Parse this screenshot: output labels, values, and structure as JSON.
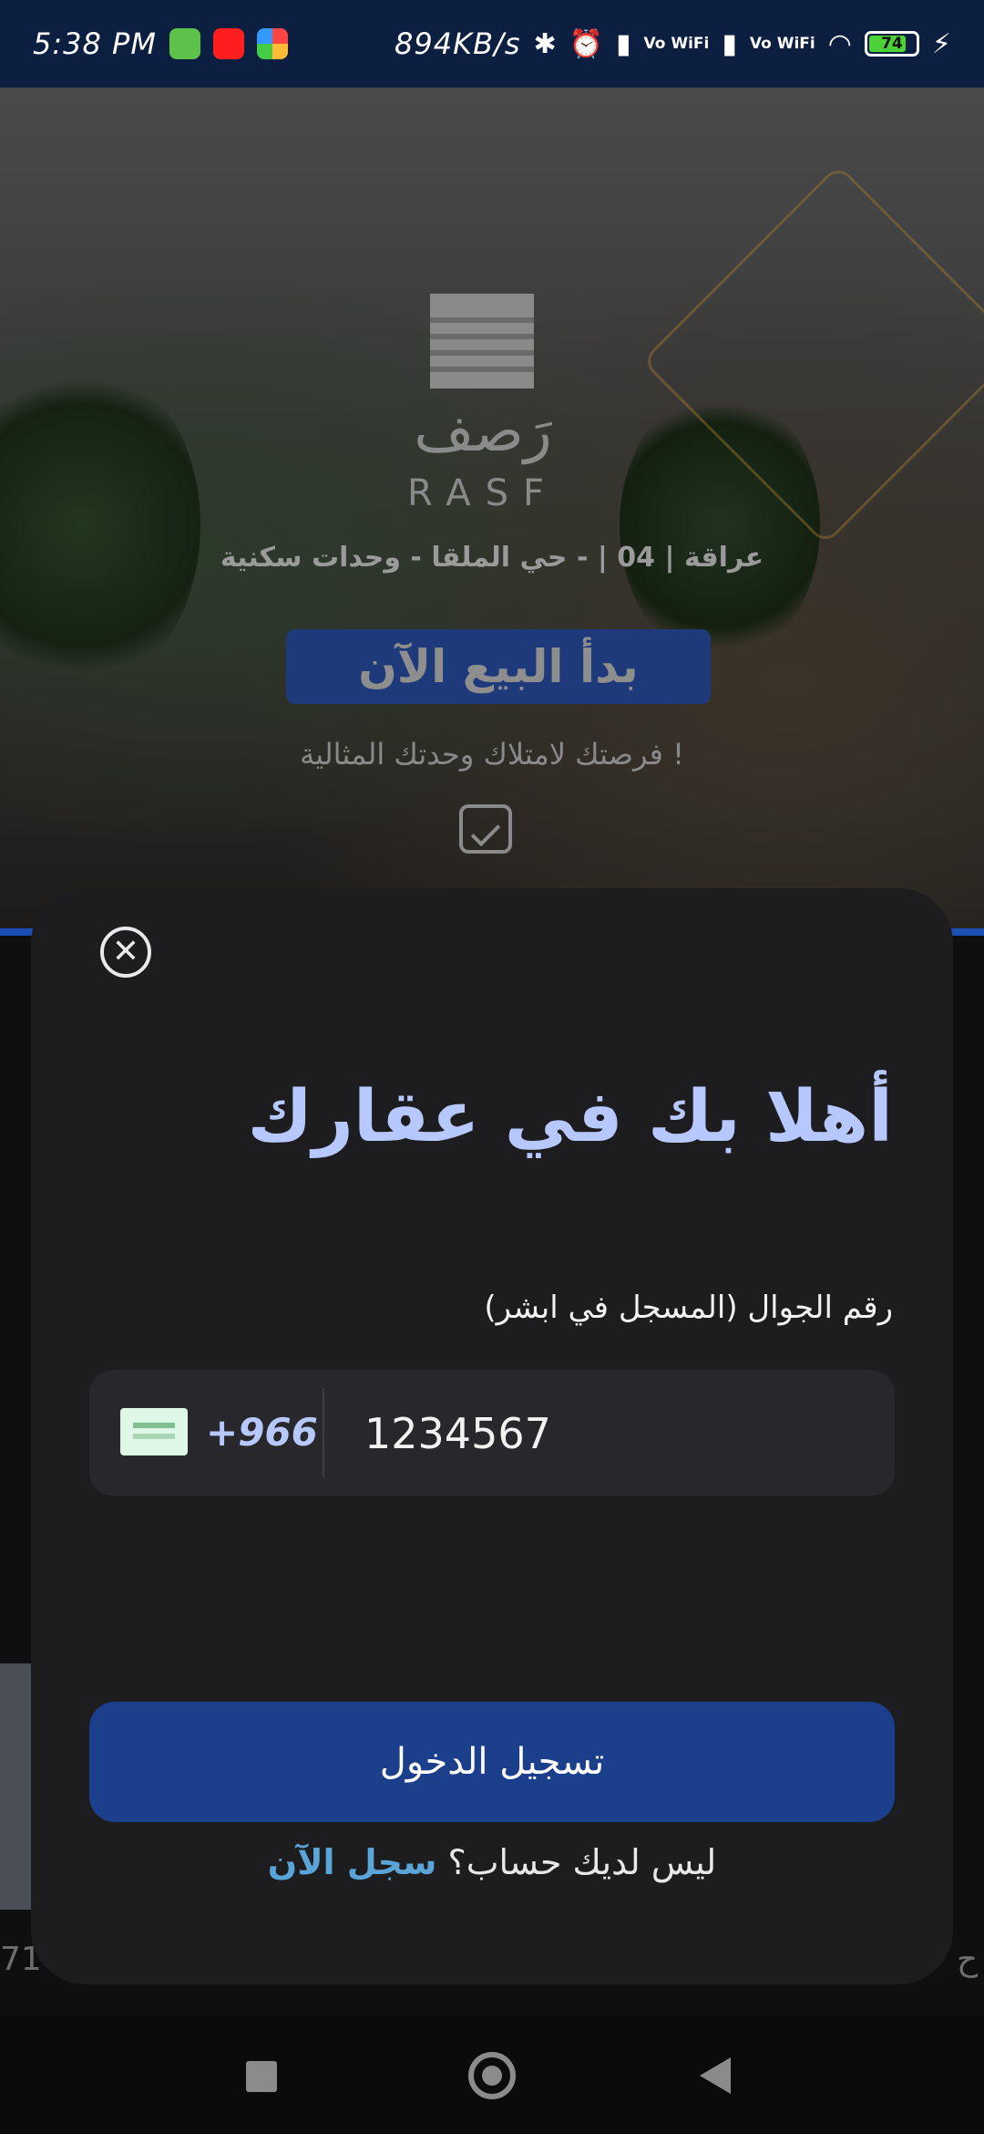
{
  "status_bar": {
    "time": "5:38 PM",
    "net_speed": "894KB/s",
    "vowifi_1": "Vo WiFi",
    "vowifi_2": "Vo WiFi",
    "battery": "74",
    "icons": [
      "messaging-app-icon",
      "youtube-icon",
      "photos-app-icon",
      "bluetooth-icon",
      "alarm-icon",
      "signal-icon",
      "signal-icon",
      "wifi-icon",
      "battery-icon",
      "charging-icon"
    ]
  },
  "hero": {
    "brand_ar": "رَصف",
    "brand_en": "RASF",
    "subtitle": "عراقة | 04 | - حي الملقا - وحدات سكنية",
    "cta": "بدأ البيع الآن",
    "tagline": "فرصتك لامتلاك وحدتك المثالية !"
  },
  "background": {
    "partial_number": "71",
    "partial_tail": "ح"
  },
  "sheet": {
    "close_icon": "close-circle-icon",
    "title": "أهلا بك في عقارك",
    "phone_label": "رقم الجوال (المسجل في ابشر)",
    "country_code": "+966",
    "phone_value": "1234567",
    "login_button": "تسجيل الدخول",
    "no_account_text": "ليس لديك حساب؟",
    "register_link": "سجل الآن"
  },
  "colors": {
    "title_accent": "#b7c8ff",
    "primary_button": "#1b3f8a",
    "link": "#5aa4d8",
    "sheet_bg": "#1d1d1f"
  },
  "nav": {
    "icons": [
      "recents-square-icon",
      "home-circle-icon",
      "back-triangle-icon"
    ]
  }
}
